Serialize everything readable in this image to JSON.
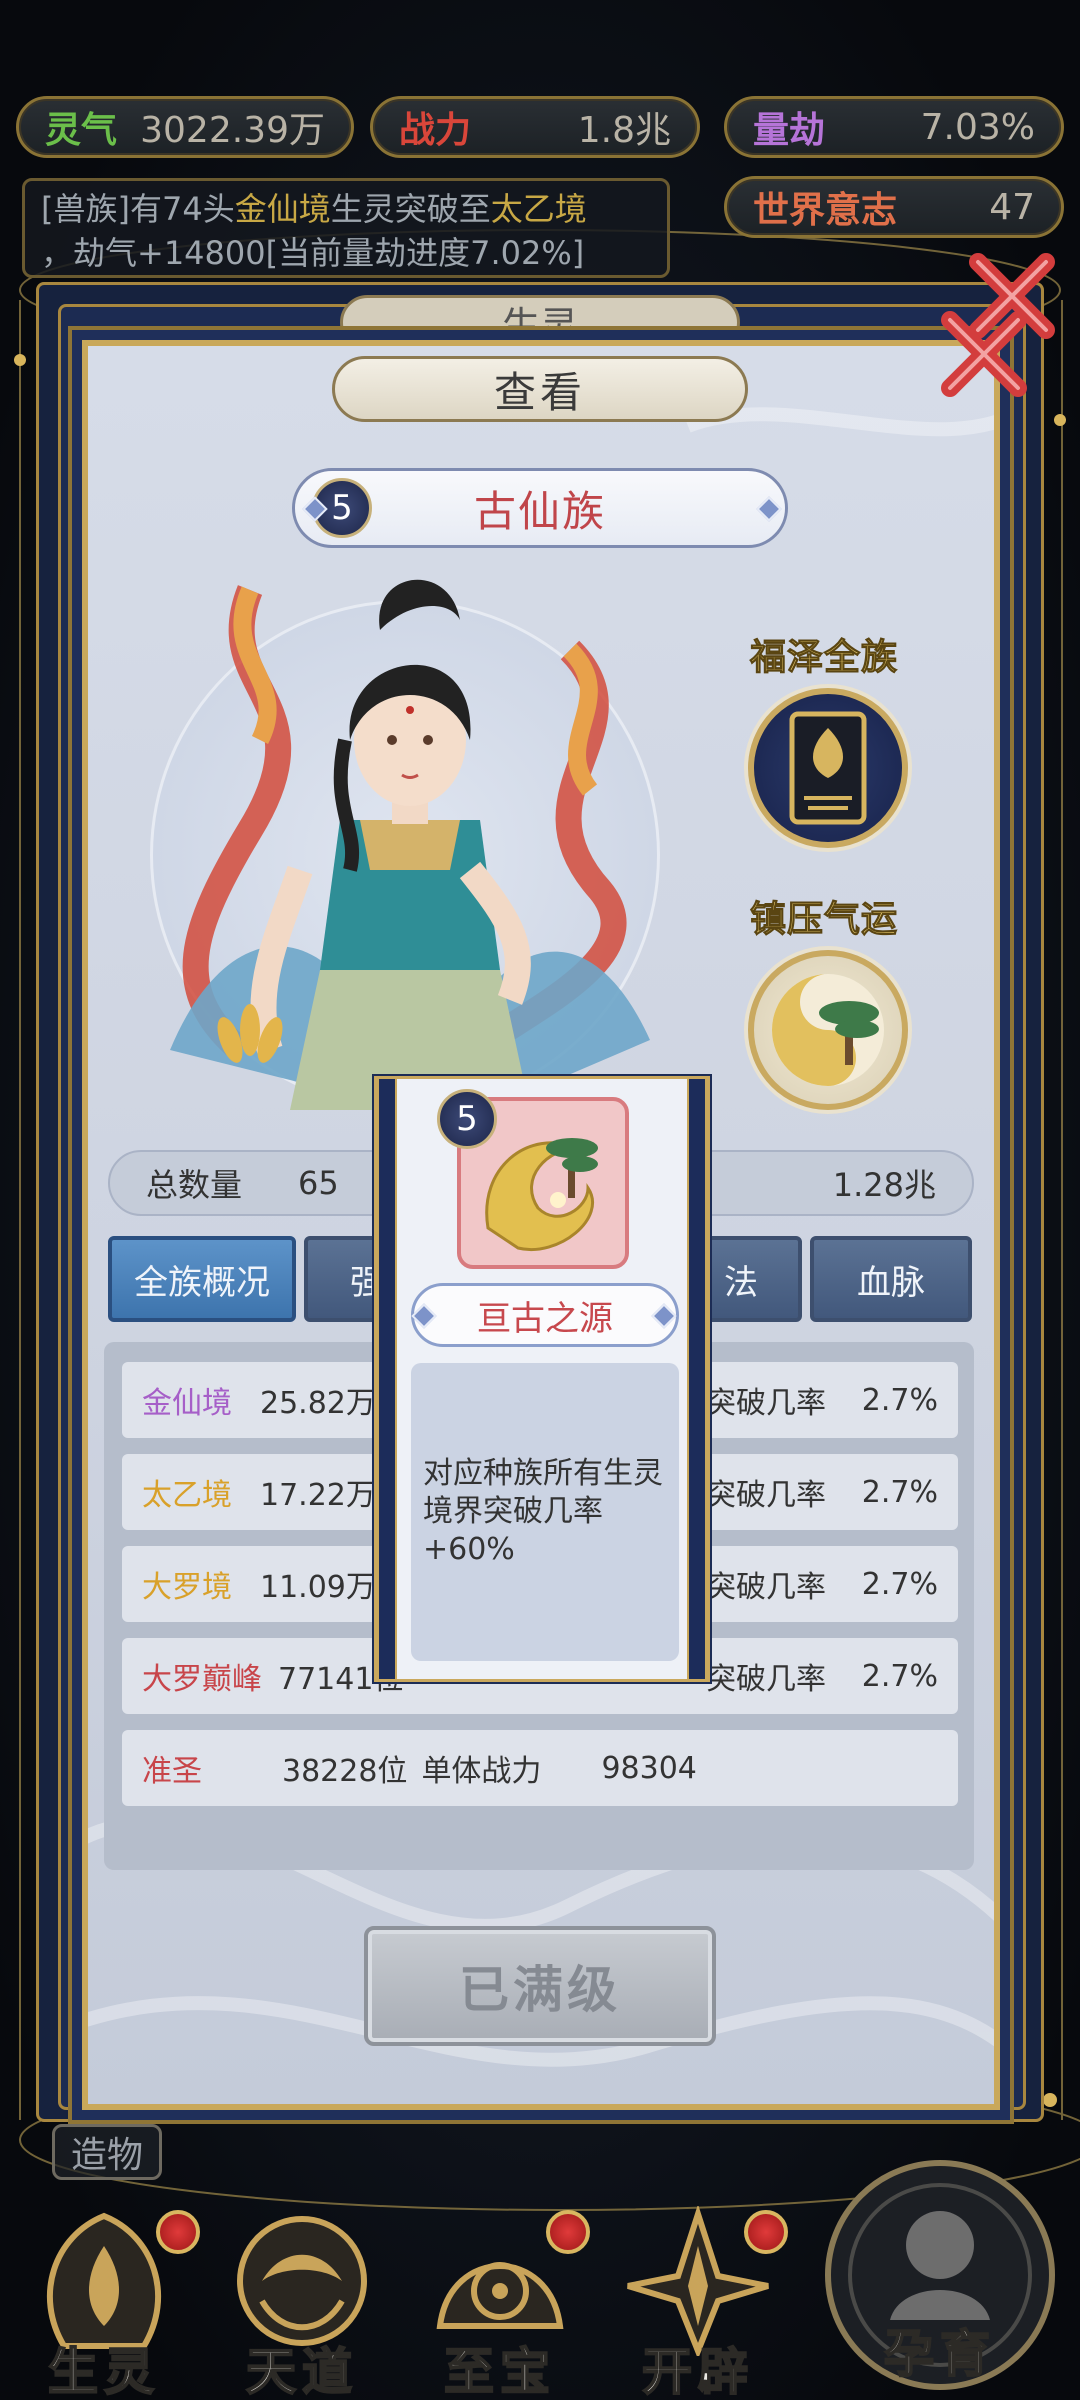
{
  "top_bar": {
    "lingqi": {
      "label": "灵气",
      "value": "3022.39万"
    },
    "zhanli": {
      "label": "战力",
      "value": "1.8兆"
    },
    "liangjie": {
      "label": "量劫",
      "value": "7.03%"
    },
    "shijie": {
      "label": "世界意志",
      "value": "47"
    }
  },
  "notice": {
    "prefix": "[兽族]有74头",
    "realm_from": "金仙境",
    "mid": "生灵突破至",
    "realm_to": "太乙境",
    "line2": "，劫气+14800[当前量劫进度7.02%]"
  },
  "under_title": "生灵",
  "panel": {
    "title": "查看",
    "race_level": "5",
    "race_name": "古仙族",
    "side_skill_1": "福泽全族",
    "side_skill_2": "镇压气运",
    "total_label": "总数量",
    "total_value": "65",
    "total_right": "1.28兆"
  },
  "tabs": [
    "全族概况",
    "强",
    "法",
    "血脉"
  ],
  "rows": [
    {
      "realm": "金仙境",
      "count": "25.82万位",
      "rate_label": "突破几率",
      "rate": "2.7%",
      "color": "#a65fc8"
    },
    {
      "realm": "太乙境",
      "count": "17.22万位",
      "rate_label": "突破几率",
      "rate": "2.7%",
      "color": "#d9a12a"
    },
    {
      "realm": "大罗境",
      "count": "11.09万位",
      "rate_label": "突破几率",
      "rate": "2.7%",
      "color": "#d9a12a"
    },
    {
      "realm": "大罗巅峰",
      "count": "77141位",
      "rate_label": "突破几率",
      "rate": "2.7%",
      "color": "#c8454a"
    }
  ],
  "last_row": {
    "realm": "准圣",
    "count": "38228位",
    "power_label": "单体战力",
    "power": "98304",
    "color": "#c8454a"
  },
  "max_button": "已满级",
  "popup": {
    "level": "5",
    "name": "亘古之源",
    "description": "对应种族所有生灵境界突破几率+60%"
  },
  "side_tag": "造物",
  "nav": [
    {
      "label": "生灵",
      "dot": true
    },
    {
      "label": "天道",
      "dot": false
    },
    {
      "label": "至宝",
      "dot": true
    },
    {
      "label": "开辟",
      "dot": true
    },
    {
      "label": "孕育",
      "dot": false
    }
  ],
  "colors": {
    "gold": "#c9a85a",
    "navy": "#1c2c5a",
    "accent_red": "#c0454a"
  }
}
